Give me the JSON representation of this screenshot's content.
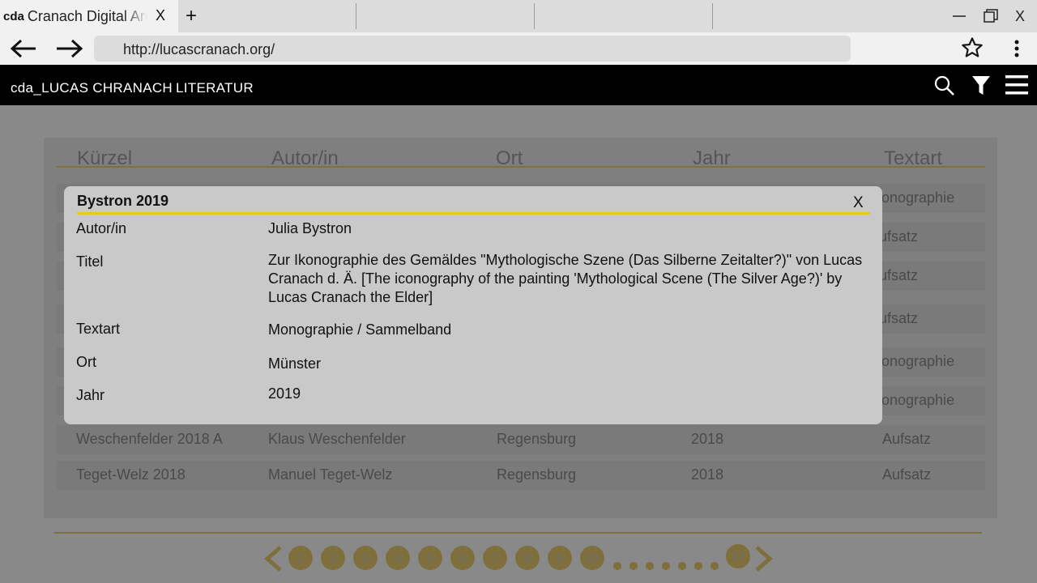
{
  "browser": {
    "tab_favicon": "cda",
    "tab_title": "Cranach Digital Archive",
    "tab_close": "X",
    "new_tab": "+",
    "url": "http://lucascranach.org/",
    "window_close": "X"
  },
  "header": {
    "brand": "cda_LUCAS CHRANACH",
    "section": "LITERATUR"
  },
  "table": {
    "columns": [
      "Kürzel",
      "Autor/in",
      "Ort",
      "Jahr",
      "Textart"
    ],
    "rows": [
      {
        "kuerzel": "",
        "autor": "",
        "ort": "",
        "jahr": "",
        "textart": "Monographie"
      },
      {
        "kuerzel": "",
        "autor": "",
        "ort": "",
        "jahr": "",
        "textart": "Aufsatz"
      },
      {
        "kuerzel": "",
        "autor": "",
        "ort": "",
        "jahr": "",
        "textart": "Aufsatz"
      },
      {
        "kuerzel": "",
        "autor": "",
        "ort": "",
        "jahr": "",
        "textart": "Aufsatz"
      },
      {
        "kuerzel": "",
        "autor": "",
        "ort": "",
        "jahr": "",
        "textart": "Monographie"
      },
      {
        "kuerzel": "",
        "autor": "",
        "ort": "",
        "jahr": "",
        "textart": "Monographie"
      },
      {
        "kuerzel": "Weschenfelder 2018 A",
        "autor": "Klaus Weschenfelder",
        "ort": "Regensburg",
        "jahr": "2018",
        "textart": "Aufsatz"
      },
      {
        "kuerzel": "Teget-Welz 2018",
        "autor": "Manuel Teget-Welz",
        "ort": "Regensburg",
        "jahr": "2018",
        "textart": "Aufsatz"
      }
    ]
  },
  "pagination": {
    "pages": [
      "1",
      "2",
      "3",
      "4",
      "5",
      "6",
      "7",
      "8",
      "9",
      "10"
    ],
    "last_page": "37"
  },
  "modal": {
    "title": "Bystron 2019",
    "close": "X",
    "fields": [
      {
        "label": "Autor/in",
        "value": "Julia Bystron"
      },
      {
        "label": "Titel",
        "value": "Zur Ikonographie des Gemäldes \"Mythologische Szene (Das Silberne Zeitalter?)\" von Lucas Cranach d. Ä. [The iconography of the painting 'Mythological Scene (The Silver Age?)' by Lucas Cranach the Elder]"
      },
      {
        "label": "Textart",
        "value": "Monographie / Sammelband"
      },
      {
        "label": "Ort",
        "value": "Münster"
      },
      {
        "label": "Jahr",
        "value": "2019"
      }
    ]
  }
}
